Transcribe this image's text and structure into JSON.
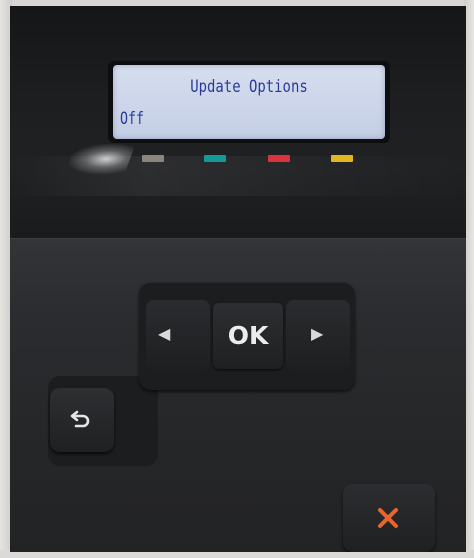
{
  "display": {
    "title": "Update Options",
    "value": "Off"
  },
  "indicators": [
    {
      "name": "gray",
      "color": "#8a867e"
    },
    {
      "name": "cyan",
      "color": "#129a98"
    },
    {
      "name": "magenta",
      "color": "#d8333f"
    },
    {
      "name": "yellow",
      "color": "#e3b521"
    }
  ],
  "controls": {
    "ok_label": "OK",
    "left_icon": "left-arrow-icon",
    "right_icon": "right-arrow-icon",
    "back_icon": "back-arrow-icon",
    "cancel_icon": "close-icon",
    "cancel_color": "#e8652d"
  }
}
